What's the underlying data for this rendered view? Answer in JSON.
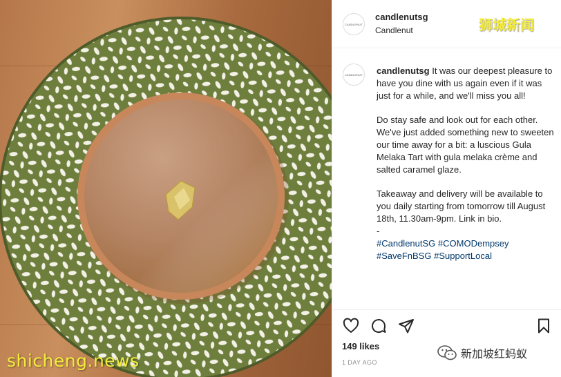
{
  "post": {
    "username": "candlenutsg",
    "location": "Candlenut",
    "avatar_text": "CANDLENUT",
    "caption": {
      "first_line": "It was our deepest pleasure to have you dine with us again even if it was just for a while, and we'll miss you all!",
      "paragraph2": "Do stay safe and look out for each other. We've just added something new to sweeten our time away for a bit: a luscious Gula Melaka Tart with gula melaka crème and salted caramel glaze.",
      "paragraph3": "Takeaway and delivery will be available to you daily starting from tomorrow till August 18th, 11.30am-9pm. Link in bio.",
      "dash": "-",
      "hashtags_line1": [
        "#CandlenutSG",
        "#COMODempsey"
      ],
      "hashtags_line2": [
        "#SaveFnBSG",
        "#SupportLocal"
      ]
    },
    "likes": "149 likes",
    "timestamp": "1 DAY AGO"
  },
  "actions": {
    "icons": [
      "heart-icon",
      "comment-icon",
      "share-icon",
      "bookmark-icon"
    ]
  },
  "watermarks": {
    "left": "shicheng.news",
    "right": "狮城新闻",
    "wechat_label": "新加坡红蚂蚁"
  },
  "colors": {
    "plate_green": "#6e7f3d",
    "tart_filling": "#b58565",
    "tart_crust": "#c8875a",
    "hashtag_link": "#00376b",
    "watermark_yellow": "#f4ec3c"
  }
}
